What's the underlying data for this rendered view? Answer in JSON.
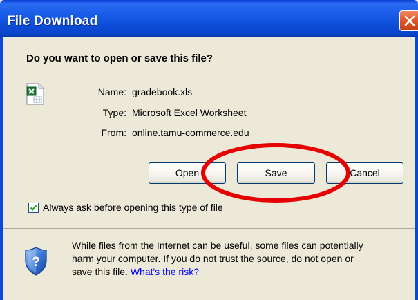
{
  "window": {
    "title": "File Download",
    "close_icon": "close-icon"
  },
  "dialog": {
    "question": "Do you want to open or save this file?",
    "file_icon": "excel-file-icon",
    "file_info": {
      "name_label": "Name:",
      "name_value": "gradebook.xls",
      "type_label": "Type:",
      "type_value": "Microsoft Excel Worksheet",
      "from_label": "From:",
      "from_value": "online.tamu-commerce.edu"
    },
    "buttons": {
      "open": "Open",
      "save": "Save",
      "cancel": "Cancel"
    },
    "checkbox": {
      "label": "Always ask before opening this type of file",
      "checked": true
    },
    "warning": {
      "icon": "security-shield-icon",
      "line1": "While files from the Internet can be useful, some files can potentially",
      "line2": "harm your computer. If you do not trust the source, do not open or",
      "line3_prefix": "save this file. ",
      "link": "What's the risk?"
    }
  },
  "annotation": {
    "shape": "ellipse",
    "target": "save-button",
    "color": "#e60000"
  },
  "colors": {
    "titlebar": "#0a46cc",
    "window_bg": "#ece9d8",
    "close_button": "#e05a2a",
    "link": "#0000ff",
    "annotation": "#e60000"
  }
}
